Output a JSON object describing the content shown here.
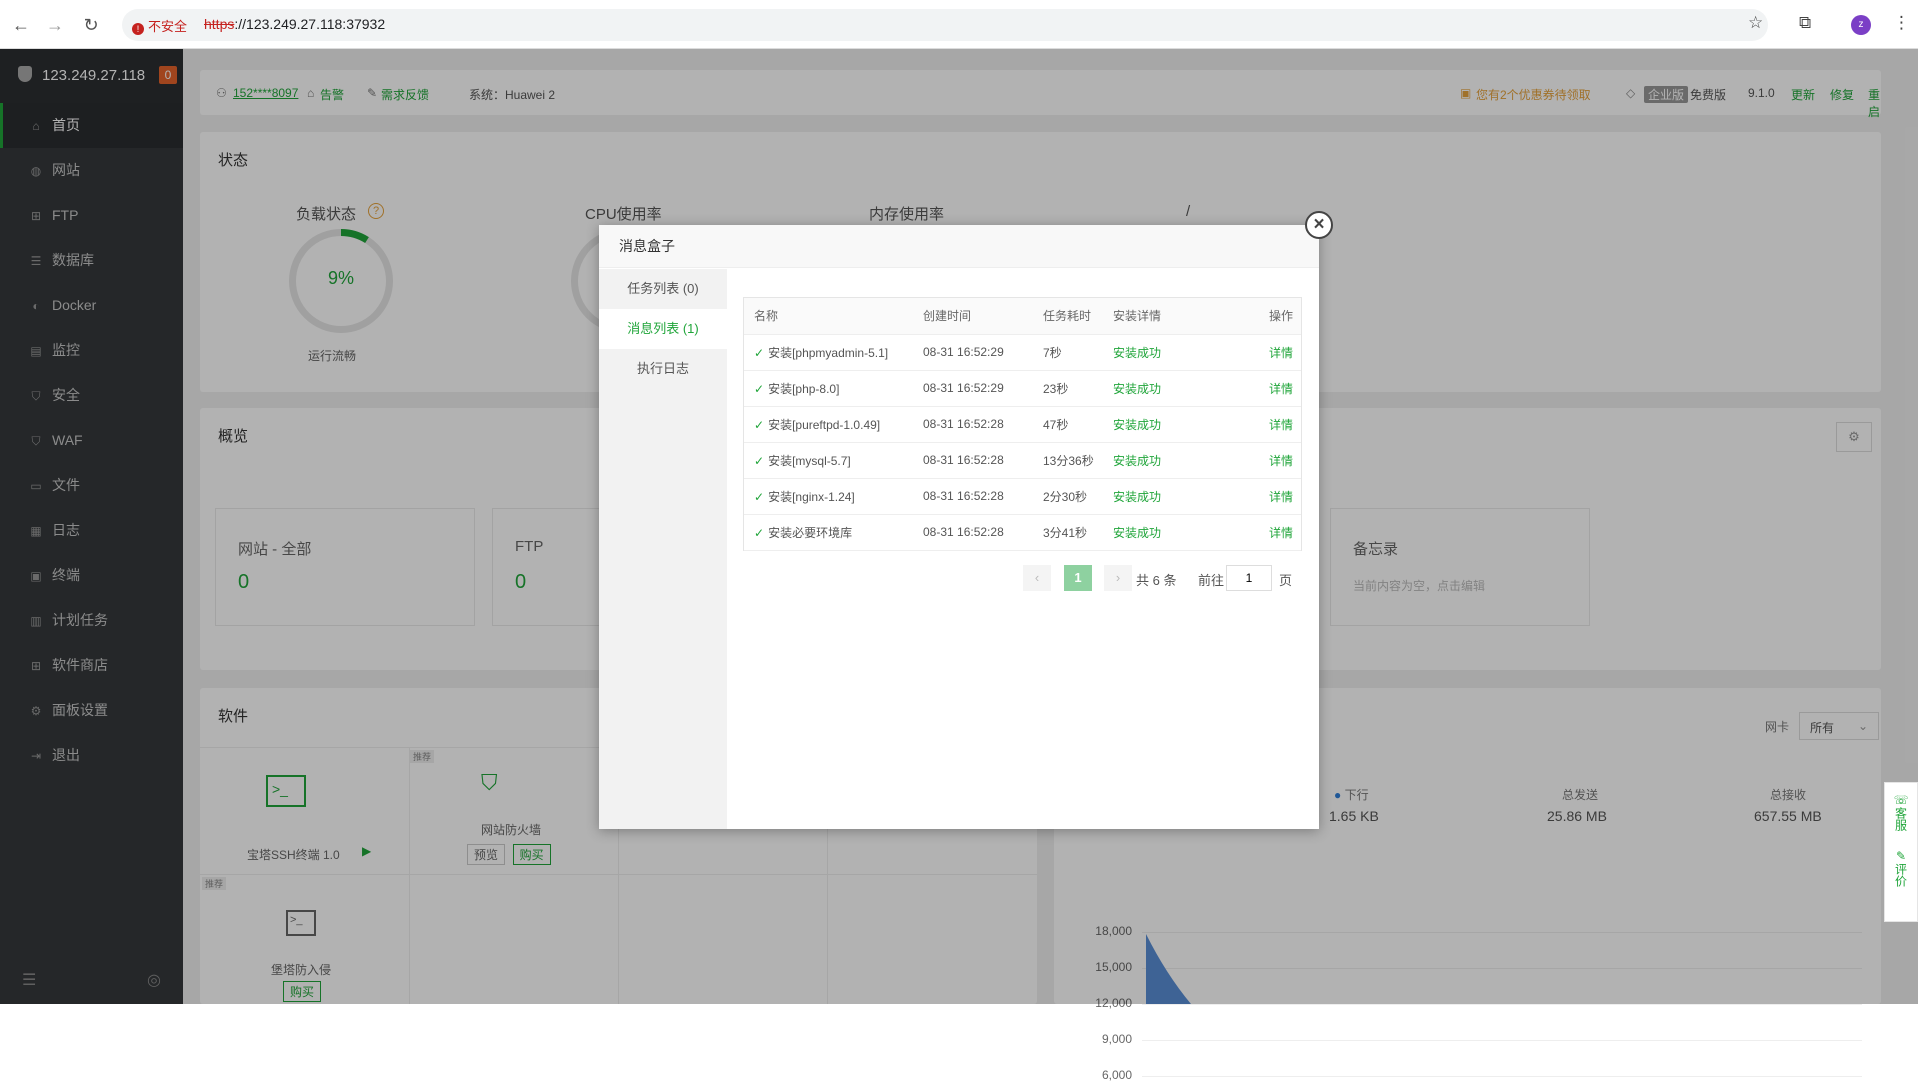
{
  "browser": {
    "insecure_label": "不安全",
    "url_scheme": "https",
    "url_rest": "://123.249.27.118:37932",
    "avatar_letter": "z"
  },
  "sidebar": {
    "server_ip": "123.249.27.118",
    "alert_count": "0",
    "items": [
      {
        "label": "首页",
        "icon": "home-icon"
      },
      {
        "label": "网站",
        "icon": "globe-icon"
      },
      {
        "label": "FTP",
        "icon": "ftp-icon"
      },
      {
        "label": "数据库",
        "icon": "database-icon"
      },
      {
        "label": "Docker",
        "icon": "docker-icon"
      },
      {
        "label": "监控",
        "icon": "monitor-icon"
      },
      {
        "label": "安全",
        "icon": "shield-icon"
      },
      {
        "label": "WAF",
        "icon": "waf-icon"
      },
      {
        "label": "文件",
        "icon": "folder-icon"
      },
      {
        "label": "日志",
        "icon": "log-icon"
      },
      {
        "label": "终端",
        "icon": "terminal-icon"
      },
      {
        "label": "计划任务",
        "icon": "calendar-icon"
      },
      {
        "label": "软件商店",
        "icon": "store-icon"
      },
      {
        "label": "面板设置",
        "icon": "gear-icon"
      },
      {
        "label": "退出",
        "icon": "logout-icon"
      }
    ]
  },
  "topbar": {
    "user": "152****8097",
    "alarm": "告警",
    "feedback": "需求反馈",
    "system": "系统：Huawei 2",
    "coupon": "您有2个优惠券待领取",
    "edition_badge": "企业版",
    "edition": "免费版",
    "version": "9.1.0",
    "update": "更新",
    "repair": "修复",
    "restart": "重启"
  },
  "status": {
    "title": "状态",
    "load_label": "负载状态",
    "load_value": "9%",
    "load_fraction": 0.09,
    "load_text": "运行流畅",
    "cpu_label": "CPU使用率",
    "mem_label": "内存使用率",
    "disk_label": "/"
  },
  "overview": {
    "title": "概览",
    "boxes": [
      {
        "label": "网站 - 全部",
        "value": "0"
      },
      {
        "label": "FTP",
        "value": "0"
      }
    ],
    "memo_title": "备忘录",
    "memo_placeholder": "当前内容为空，点击编辑"
  },
  "software": {
    "title": "软件",
    "items": [
      {
        "name": "宝塔SSH终端 1.0",
        "tag": ""
      },
      {
        "name": "网站防火墙",
        "tag": "推荐",
        "btn1": "预览",
        "btn2": "购买"
      },
      {
        "name": "堡塔防入侵",
        "tag": "推荐",
        "btn2": "购买"
      }
    ]
  },
  "traffic": {
    "nic_label": "网卡",
    "nic_value": "所有",
    "down_label": "下行",
    "down_value": "1.65 KB",
    "sent_label": "总发送",
    "sent_value": "25.86 MB",
    "recv_label": "总接收",
    "recv_value": "657.55 MB",
    "y_ticks": [
      "18,000",
      "15,000",
      "12,000",
      "9,000",
      "6,000"
    ]
  },
  "modal": {
    "title": "消息盒子",
    "tabs": [
      "任务列表 (0)",
      "消息列表 (1)",
      "执行日志"
    ],
    "columns": [
      "名称",
      "创建时间",
      "任务耗时",
      "安装详情",
      "操作"
    ],
    "rows": [
      {
        "name": "安装[phpmyadmin-5.1]",
        "time": "08-31 16:52:29",
        "cost": "7秒",
        "status": "安装成功",
        "action": "详情"
      },
      {
        "name": "安装[php-8.0]",
        "time": "08-31 16:52:29",
        "cost": "23秒",
        "status": "安装成功",
        "action": "详情"
      },
      {
        "name": "安装[pureftpd-1.0.49]",
        "time": "08-31 16:52:28",
        "cost": "47秒",
        "status": "安装成功",
        "action": "详情"
      },
      {
        "name": "安装[mysql-5.7]",
        "time": "08-31 16:52:28",
        "cost": "13分36秒",
        "status": "安装成功",
        "action": "详情"
      },
      {
        "name": "安装[nginx-1.24]",
        "time": "08-31 16:52:28",
        "cost": "2分30秒",
        "status": "安装成功",
        "action": "详情"
      },
      {
        "name": "安装必要环境库",
        "time": "08-31 16:52:28",
        "cost": "3分41秒",
        "status": "安装成功",
        "action": "详情"
      }
    ],
    "pager": {
      "current": "1",
      "total": "共 6 条",
      "goto": "前往",
      "goto_value": "1",
      "page_unit": "页"
    }
  },
  "float": {
    "service": "客服",
    "review": "评价"
  }
}
